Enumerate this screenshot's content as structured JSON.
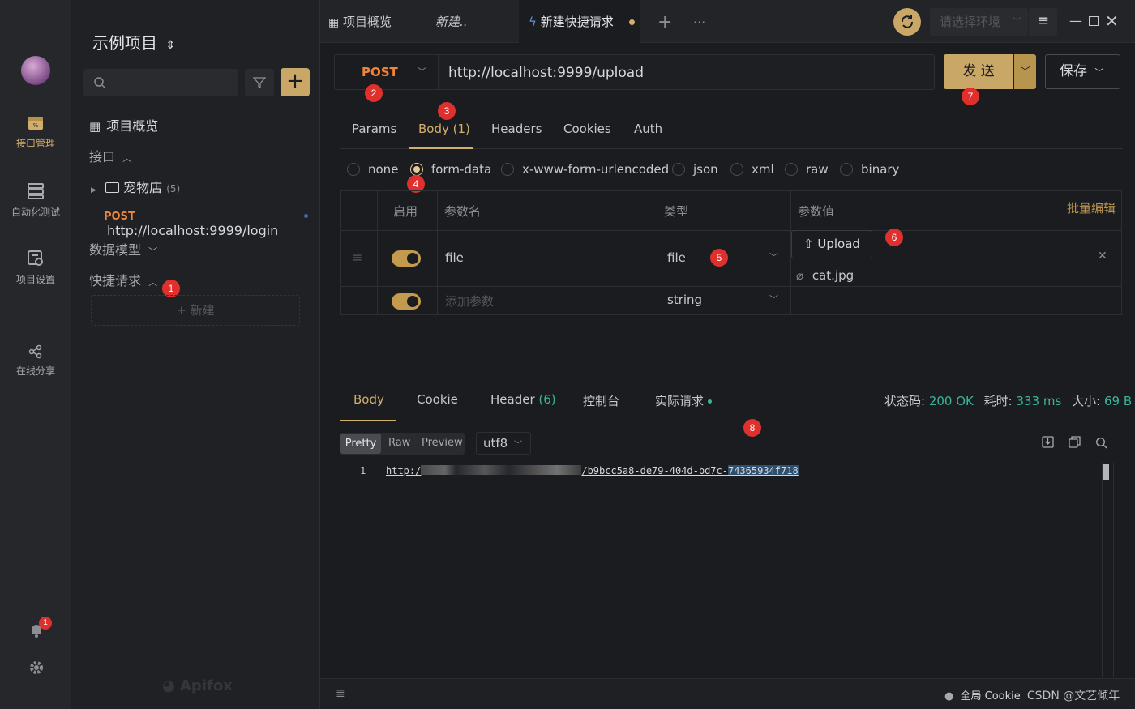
{
  "rail": {
    "items": [
      {
        "label": "接口管理",
        "icon": "api-icon"
      },
      {
        "label": "自动化测试",
        "icon": "automation-icon"
      },
      {
        "label": "项目设置",
        "icon": "project-settings-icon"
      },
      {
        "label": "在线分享",
        "icon": "share-icon"
      }
    ],
    "notification_count": "1"
  },
  "sidebar": {
    "project_name": "示例项目",
    "search_placeholder": "",
    "overview": "项目概览",
    "section_api": "接口",
    "folder_name": "宠物店",
    "folder_count": "(5)",
    "api_method": "POST",
    "api_url": "http://localhost:9999/login",
    "section_models": "数据模型",
    "section_quick": "快捷请求",
    "new_label": "新建",
    "brand": "Apifox"
  },
  "tabs": {
    "items": [
      "项目概览",
      "新建..",
      "新建快捷请求"
    ],
    "env_placeholder": "请选择环境"
  },
  "request": {
    "method": "POST",
    "url": "http://localhost:9999/upload",
    "send_label": "发 送",
    "save_label": "保存",
    "subtabs": {
      "params": "Params",
      "body": "Body",
      "body_count": "(1)",
      "headers": "Headers",
      "cookies": "Cookies",
      "auth": "Auth"
    },
    "body_types": [
      "none",
      "form-data",
      "x-www-form-urlencoded",
      "json",
      "xml",
      "raw",
      "binary"
    ],
    "selected_body_type": "form-data",
    "table": {
      "headers": {
        "enabled": "启用",
        "name": "参数名",
        "type": "类型",
        "value": "参数值"
      },
      "bulk_edit": "批量编辑",
      "rows": [
        {
          "name": "file",
          "type": "file",
          "upload_label": "Upload",
          "file_name": "cat.jpg",
          "enabled": true
        },
        {
          "name_placeholder": "添加参数",
          "type": "string",
          "enabled": true
        }
      ]
    }
  },
  "response": {
    "tabs": {
      "body": "Body",
      "cookie": "Cookie",
      "header": "Header",
      "header_count": "(6)",
      "console": "控制台",
      "actual": "实际请求"
    },
    "status_label": "状态码:",
    "status_value": "200 OK",
    "time_label": "耗时:",
    "time_value": "333 ms",
    "size_label": "大小:",
    "size_value": "69 B",
    "view_modes": [
      "Pretty",
      "Raw",
      "Preview"
    ],
    "encoding": "utf8",
    "line_number": "1",
    "body_text_prefix": "http:/",
    "body_text_suffix": "/b9bcc5a8-de79-404d-bd7c-",
    "body_text_selected": "74365934f718"
  },
  "footer": {
    "cookie_label": "全局 Cookie",
    "watermark": "CSDN @文艺倾年"
  },
  "annotations": [
    "1",
    "2",
    "3",
    "4",
    "5",
    "6",
    "7",
    "8"
  ],
  "colors": {
    "accent": "#d2ae6d",
    "post": "#f0843a",
    "badge": "#e0302d",
    "success": "#3bb39a"
  }
}
